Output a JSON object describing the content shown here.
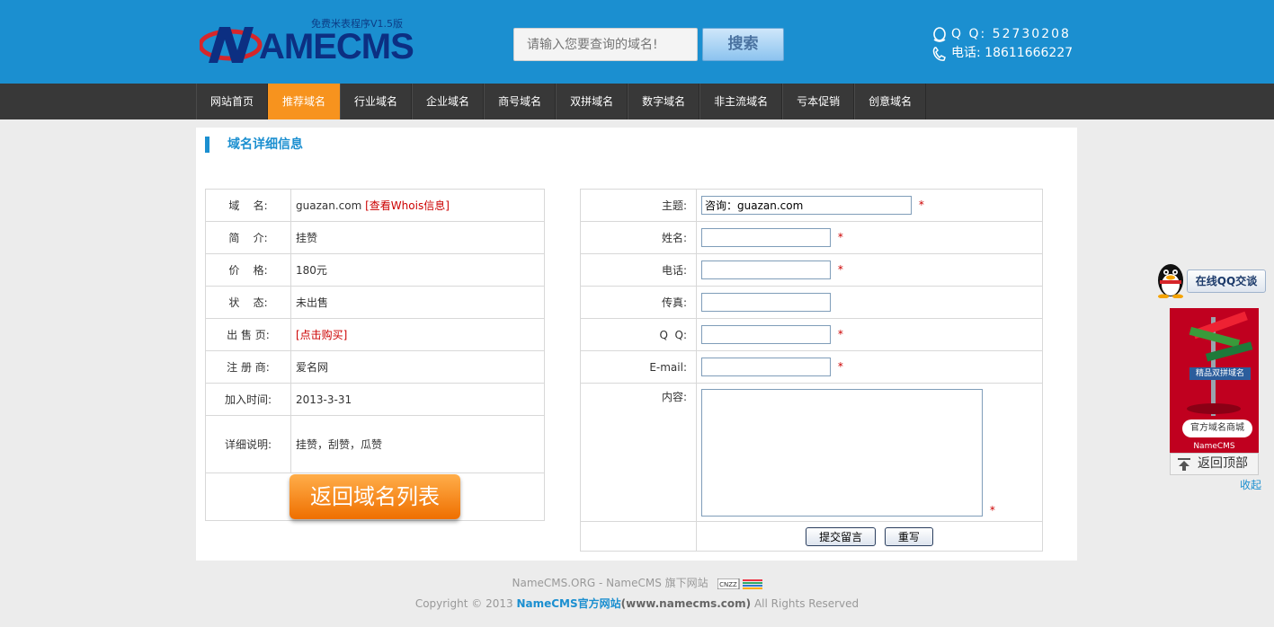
{
  "header": {
    "logo_sub": "免费米表程序V1.5版",
    "logo_text": "AMECMS",
    "search_placeholder": "请输入您要查询的域名!",
    "search_button": "搜索",
    "qq": "Q Q: 52730208",
    "tel": "电话: 18611666227"
  },
  "nav": {
    "items": [
      "网站首页",
      "推荐域名",
      "行业域名",
      "企业域名",
      "商号域名",
      "双拼域名",
      "数字域名",
      "非主流域名",
      "亏本促销",
      "创意域名"
    ],
    "active": 1
  },
  "section_title": "域名详细信息",
  "info": {
    "domain_label": "域    名:",
    "domain_value": "guazan.com",
    "whois_link": "[查看Whois信息]",
    "intro_label": "简    介:",
    "intro_value": "挂赞",
    "price_label": "价    格:",
    "price_value": "180元",
    "status_label": "状    态:",
    "status_value": "未出售",
    "sale_label": "出 售 页:",
    "sale_link": "[点击购买]",
    "registrar_label": "注 册 商:",
    "registrar_value": "爱名网",
    "added_label": "加入时间:",
    "added_value": "2013-3-31",
    "detail_label": "详细说明:",
    "detail_value": "挂赞，刮赞，瓜赞",
    "back_button": "返回域名列表"
  },
  "form": {
    "subject_label": "主题:",
    "subject_value": "咨询：guazan.com",
    "name_label": "姓名:",
    "phone_label": "电话:",
    "fax_label": "传真:",
    "qq_label": "Q  Q:",
    "email_label": "E-mail:",
    "content_label": "内容:",
    "required_mark": "*",
    "submit_button": "提交留言",
    "reset_button": "重写"
  },
  "footer": {
    "line1": "NameCMS.ORG - NameCMS 旗下网站",
    "cnzz": "CNZZ",
    "copyright": "Copyright © 2013",
    "brand": "NameCMS官方网站",
    "site": "(www.namecms.com)",
    "rights": "All Rights Reserved"
  },
  "float": {
    "qq_chat": "在线QQ交谈",
    "ad_tag": "精品双拼域名",
    "ad_label": "官方域名商城",
    "ad_sub": "NameCMS",
    "to_top": "返回顶部",
    "collapse": "收起"
  },
  "colors": {
    "header_bg": "#1b8fd0",
    "nav_bg": "#383838",
    "nav_active": "#f7931e",
    "accent": "#1b8fd0",
    "required": "#cc0000"
  }
}
